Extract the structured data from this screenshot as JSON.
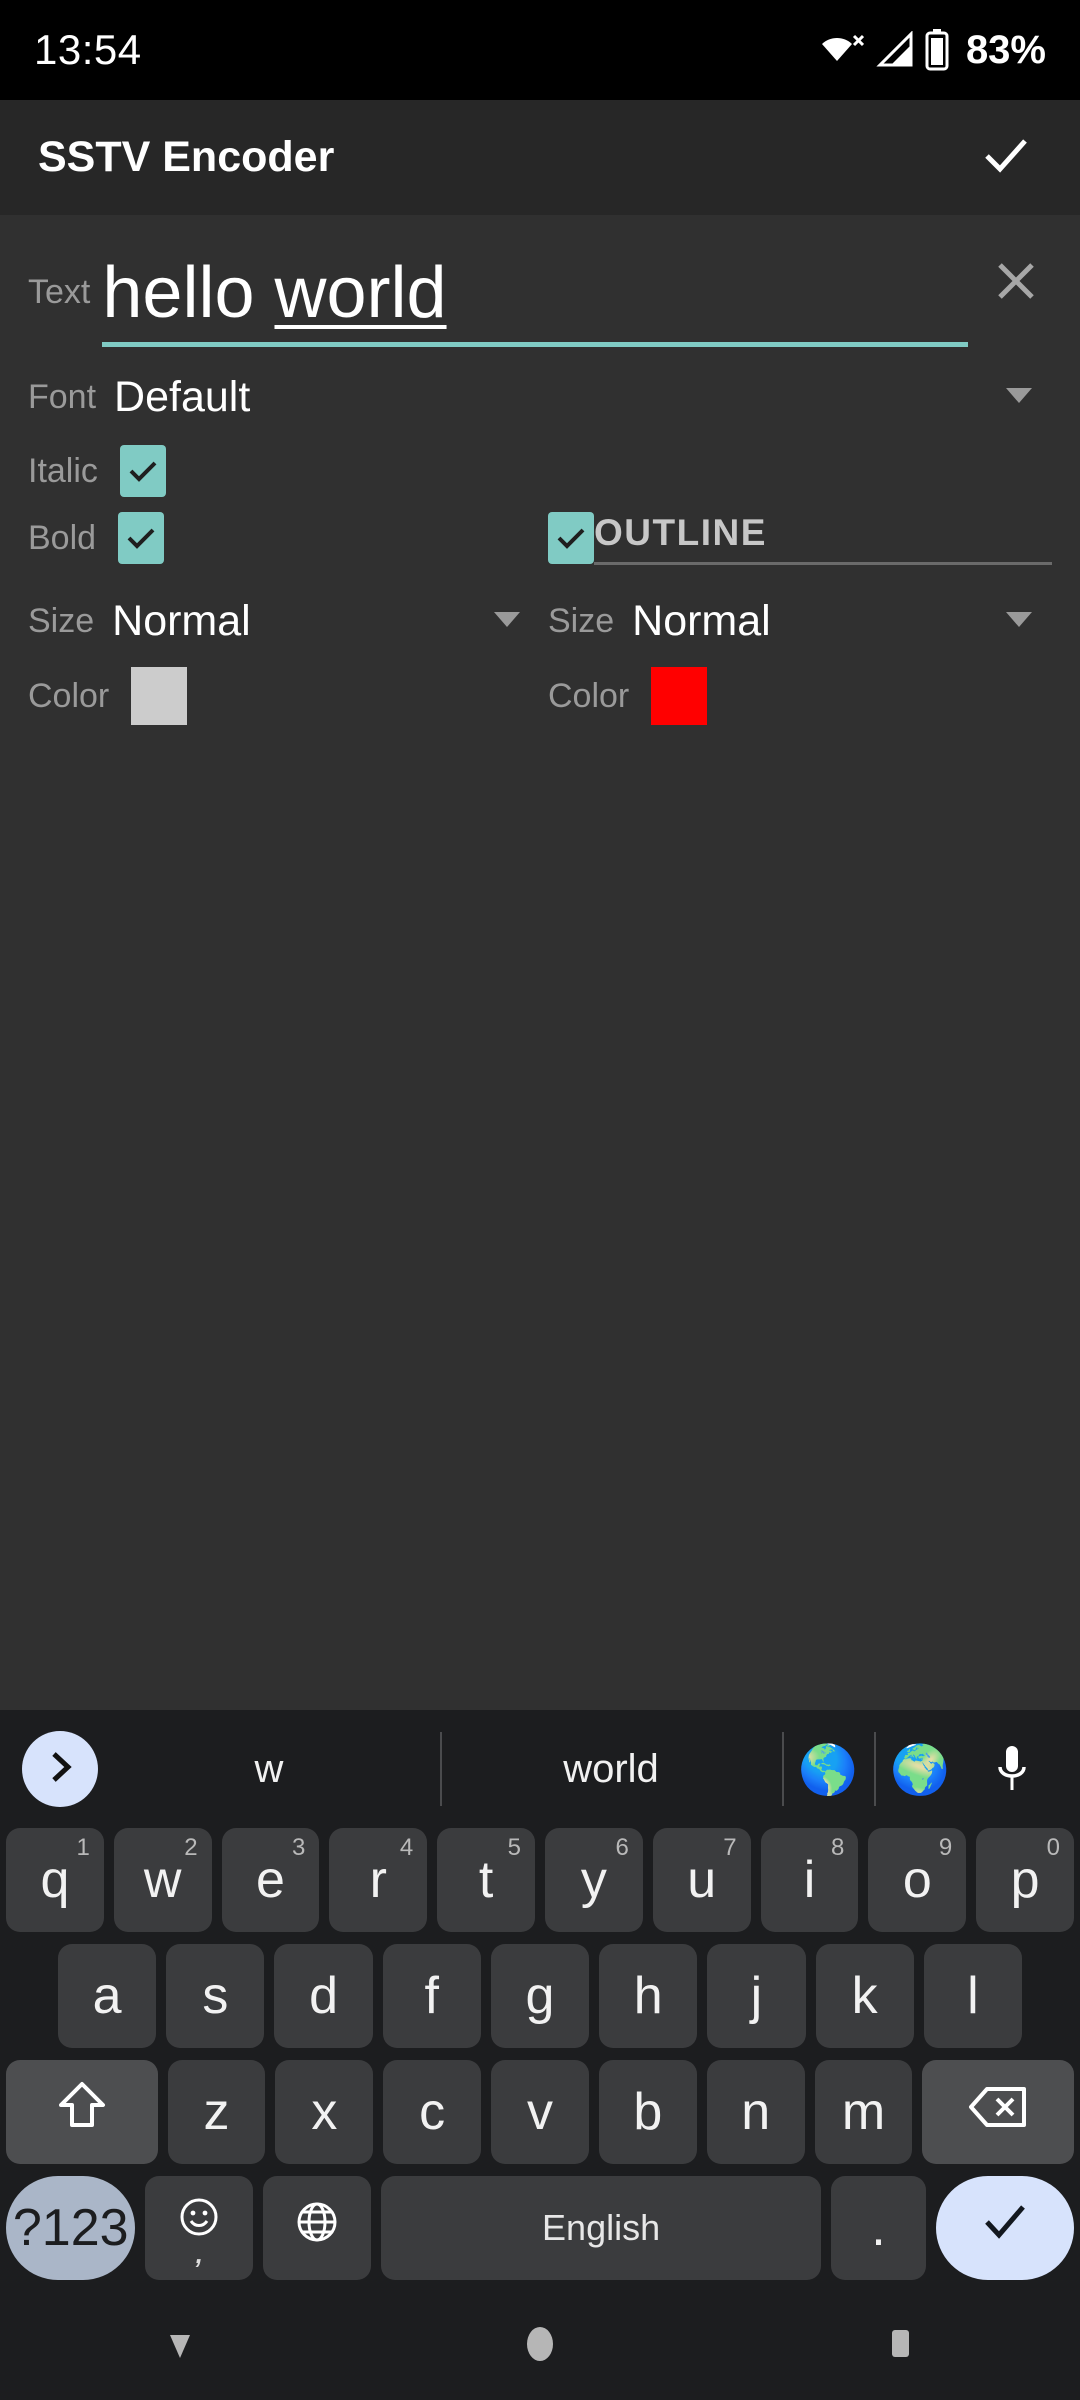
{
  "status_bar": {
    "clock": "13:54",
    "battery_percent": "83%",
    "icons": [
      "wifi-no-internet-icon",
      "cellular-signal-icon",
      "battery-icon"
    ]
  },
  "app_bar": {
    "title": "SSTV Encoder",
    "confirm_label": "✓",
    "confirm_icon": "check-icon"
  },
  "form": {
    "text": {
      "label": "Text",
      "value": "hello ",
      "value_composing": "world",
      "placeholder": "Text",
      "clear_icon": "close-icon",
      "underline_color": "#80cbc4"
    },
    "font": {
      "label": "Font",
      "value": "Default",
      "caret_icon": "chevron-down-icon"
    },
    "italic": {
      "label": "Italic",
      "checked": true
    },
    "bold": {
      "label": "Bold",
      "checked": true
    },
    "size": {
      "label": "Size",
      "value": "Normal",
      "caret_icon": "chevron-down-icon"
    },
    "color": {
      "label": "Color",
      "value": "#cccccc"
    },
    "outline": {
      "title": "OUTLINE",
      "checked": true,
      "size": {
        "label": "Size",
        "value": "Normal",
        "caret_icon": "chevron-down-icon"
      },
      "color": {
        "label": "Color",
        "value": "#ff0000"
      }
    },
    "accent_color": "#80cbc4"
  },
  "keyboard": {
    "expand_icon": "chevron-right-icon",
    "suggestions": [
      "w",
      "world"
    ],
    "toolbar_icons": [
      "globe-americas-emoji",
      "globe-africa-emoji",
      "microphone-icon"
    ],
    "toolbar_glyphs": [
      "🌎",
      "🌍",
      "🎤"
    ],
    "row1": [
      {
        "key": "q",
        "alt": "1"
      },
      {
        "key": "w",
        "alt": "2"
      },
      {
        "key": "e",
        "alt": "3"
      },
      {
        "key": "r",
        "alt": "4"
      },
      {
        "key": "t",
        "alt": "5"
      },
      {
        "key": "y",
        "alt": "6"
      },
      {
        "key": "u",
        "alt": "7"
      },
      {
        "key": "i",
        "alt": "8"
      },
      {
        "key": "o",
        "alt": "9"
      },
      {
        "key": "p",
        "alt": "0"
      }
    ],
    "row2": [
      "a",
      "s",
      "d",
      "f",
      "g",
      "h",
      "j",
      "k",
      "l"
    ],
    "row3": [
      "z",
      "x",
      "c",
      "v",
      "b",
      "n",
      "m"
    ],
    "shift_icon": "shift-icon",
    "backspace_icon": "backspace-icon",
    "numeric_label": "?123",
    "emoji_icon": "emoji-icon",
    "comma_label": ",",
    "language_icon": "globe-icon",
    "space_label": "English",
    "period_label": ".",
    "enter_icon": "check-icon"
  },
  "nav_bar": {
    "back_icon": "triangle-down-icon",
    "home_icon": "circle-icon",
    "recents_icon": "square-icon"
  }
}
